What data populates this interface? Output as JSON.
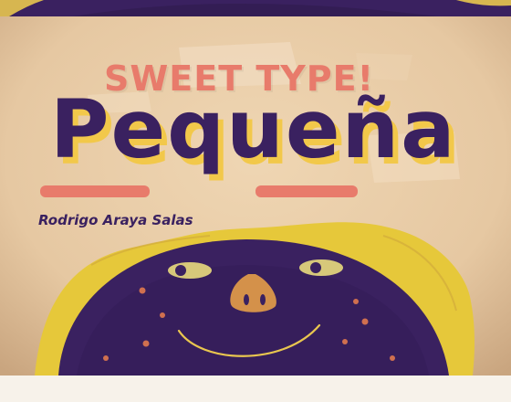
{
  "tagline": "SWEET TYPE!",
  "title": "Pequeña",
  "author": "Rodrigo Araya Salas",
  "colors": {
    "background": "#f4ede2",
    "paper_light": "#ebcfac",
    "paper_dark": "#d9b893",
    "purple": "#3a2160",
    "coral": "#e87b6b",
    "yellow": "#f2c84a",
    "nose": "#d4914a",
    "frame": "#f7f2ea"
  },
  "character": {
    "icons": [
      "mascot-face-icon",
      "mascot-eye-icon",
      "mascot-nose-icon",
      "mascot-smile-icon"
    ]
  }
}
